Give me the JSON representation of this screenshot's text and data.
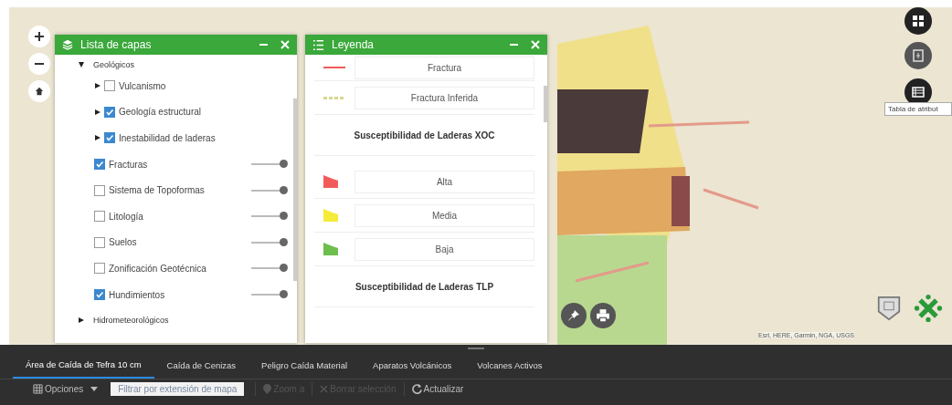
{
  "layer_list": {
    "title": "Lista de capas",
    "groups": [
      {
        "label": "Geológicos",
        "expanded": true,
        "children": [
          {
            "label": "Vulcanismo",
            "kind": "group",
            "expanded": false,
            "checked": false
          },
          {
            "label": "Geología estructural",
            "kind": "group",
            "expanded": false,
            "checked": true
          },
          {
            "label": "Inestabilidad de laderas",
            "kind": "group",
            "expanded": false,
            "checked": true
          },
          {
            "label": "Fracturas",
            "kind": "layer",
            "checked": true,
            "level": 1
          },
          {
            "label": "Sistema de Topoformas",
            "kind": "layer",
            "checked": false,
            "level": 1
          },
          {
            "label": "Litología",
            "kind": "layer",
            "checked": false,
            "level": 1
          },
          {
            "label": "Suelos",
            "kind": "layer",
            "checked": false,
            "level": 1
          },
          {
            "label": "Zonificación Geotécnica",
            "kind": "layer",
            "checked": false,
            "level": 1
          },
          {
            "label": "Hundimientos",
            "kind": "layer",
            "checked": true,
            "level": 1
          }
        ]
      },
      {
        "label": "Hidrometeorológicos",
        "expanded": false
      }
    ]
  },
  "legend": {
    "title": "Leyenda",
    "items": [
      {
        "kind": "line",
        "color": "#f05a5a",
        "label": "Fractura"
      },
      {
        "kind": "dashed",
        "color": "#d8d890",
        "label": "Fractura Inferida"
      },
      {
        "kind": "heading",
        "label": "Susceptibilidad de Laderas XOC"
      },
      {
        "kind": "polygon",
        "color": "#f25b5b",
        "label": "Alta"
      },
      {
        "kind": "polygon",
        "color": "#f5ec3a",
        "label": "Media"
      },
      {
        "kind": "polygon",
        "color": "#6ebe4e",
        "label": "Baja"
      },
      {
        "kind": "heading",
        "label": "Susceptibilidad de Laderas TLP"
      }
    ]
  },
  "map": {
    "tooltip": "Tabla de atribut",
    "attribution": "Esri, HERE, Garmin, NGA, USGS"
  },
  "attribute_table": {
    "tabs": [
      {
        "label": "Área de Caída de Tefra 10 cm",
        "selected": true
      },
      {
        "label": "Caída de Cenizas",
        "selected": false
      },
      {
        "label": "Peligro Caída Material",
        "selected": false
      },
      {
        "label": "Aparatos Volcánicos",
        "selected": false
      },
      {
        "label": "Volcanes Activos",
        "selected": false
      }
    ],
    "toolbar": [
      {
        "kind": "menu",
        "label": "Opciones",
        "disabled": false
      },
      {
        "kind": "toggle",
        "label": "Filtrar por extensión de mapa",
        "disabled": false
      },
      {
        "kind": "zoom",
        "label": "Zoom a",
        "disabled": true
      },
      {
        "kind": "clear",
        "label": "Borrar selección",
        "disabled": true
      },
      {
        "kind": "refresh",
        "label": "Actualizar",
        "disabled": false
      }
    ]
  }
}
